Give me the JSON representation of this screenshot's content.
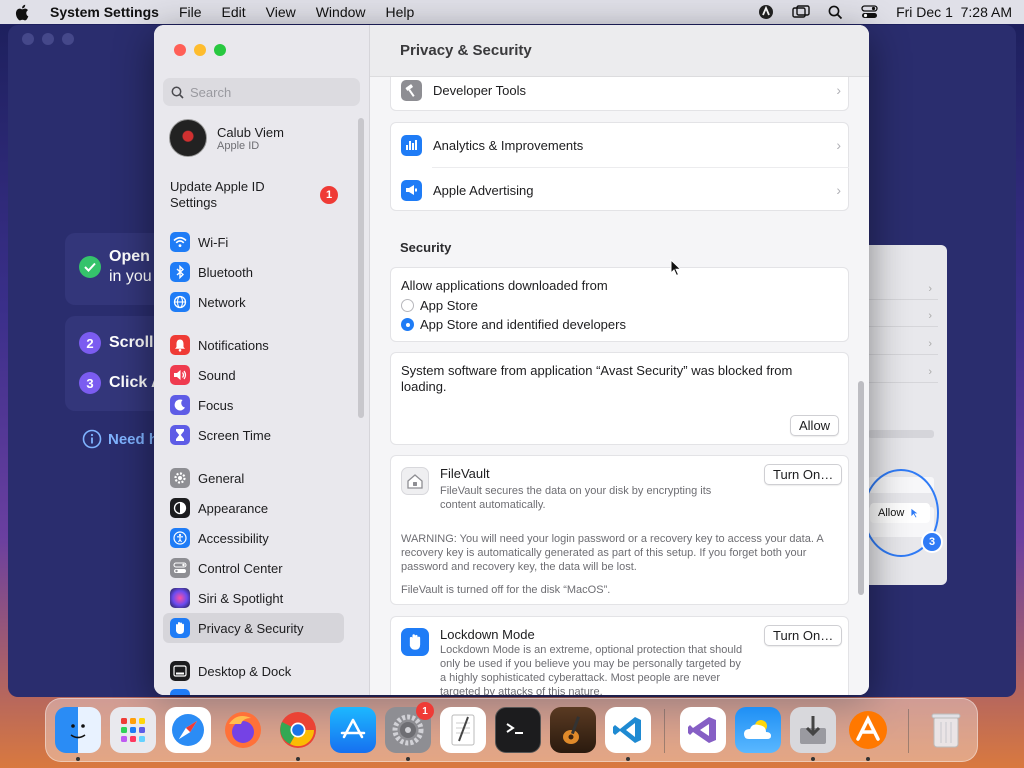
{
  "menubar": {
    "app_name": "System Settings",
    "menus": [
      "File",
      "Edit",
      "View",
      "Window",
      "Help"
    ],
    "datetime": "Fri Dec 1  7:28 AM"
  },
  "background_app": {
    "steps": [
      {
        "badge": "",
        "line1": "Open",
        "line2": "in you"
      },
      {
        "badge": "2",
        "text": "Scroll"
      },
      {
        "badge": "3",
        "text": "Click A"
      }
    ],
    "need_help": "Need h",
    "preview": {
      "allow_label": "Allow",
      "badge": "3"
    }
  },
  "sidebar": {
    "search_placeholder": "Search",
    "profile": {
      "name": "Calub Viem",
      "subtitle": "Apple ID"
    },
    "update": {
      "label": "Update Apple ID Settings",
      "badge": "1"
    },
    "items": [
      {
        "label": "Wi-Fi",
        "icon": "wifi-icon",
        "color": "#1f7cf6"
      },
      {
        "label": "Bluetooth",
        "icon": "bluetooth-icon",
        "color": "#1f7cf6"
      },
      {
        "label": "Network",
        "icon": "globe-icon",
        "color": "#1f7cf6"
      },
      {
        "label": "Notifications",
        "icon": "bell-icon",
        "color": "#ef3b36"
      },
      {
        "label": "Sound",
        "icon": "speaker-icon",
        "color": "#ef3b4f"
      },
      {
        "label": "Focus",
        "icon": "moon-icon",
        "color": "#5e5ce6"
      },
      {
        "label": "Screen Time",
        "icon": "hourglass-icon",
        "color": "#5e5ce6"
      },
      {
        "label": "General",
        "icon": "gear-icon",
        "color": "#8e8e93"
      },
      {
        "label": "Appearance",
        "icon": "appearance-icon",
        "color": "#1c1c1e"
      },
      {
        "label": "Accessibility",
        "icon": "accessibility-icon",
        "color": "#1f7cf6"
      },
      {
        "label": "Control Center",
        "icon": "switches-icon",
        "color": "#8e8e93"
      },
      {
        "label": "Siri & Spotlight",
        "icon": "siri-icon",
        "color": "#2b2b6e"
      },
      {
        "label": "Privacy & Security",
        "icon": "hand-icon",
        "color": "#1f7cf6"
      },
      {
        "label": "Desktop & Dock",
        "icon": "dock-icon",
        "color": "#1c1c1e"
      }
    ]
  },
  "content": {
    "title": "Privacy & Security",
    "rows_top": [
      {
        "label": "Developer Tools",
        "icon": "hammer-icon"
      },
      {
        "label": "Analytics & Improvements",
        "icon": "chart-icon"
      },
      {
        "label": "Apple Advertising",
        "icon": "megaphone-icon"
      }
    ],
    "security_title": "Security",
    "allow_from_label": "Allow applications downloaded from",
    "radio_options": [
      "App Store",
      "App Store and identified developers"
    ],
    "blocked_message": "System software from application “Avast Security” was blocked from loading.",
    "allow_button": "Allow",
    "filevault": {
      "title": "FileVault",
      "description": "FileVault secures the data on your disk by encrypting its content automatically.",
      "button": "Turn On…",
      "warning": "WARNING: You will need your login password or a recovery key to access your data. A recovery key is automatically generated as part of this setup. If you forget both your password and recovery key, the data will be lost.",
      "status": "FileVault is turned off for the disk “MacOS”."
    },
    "lockdown": {
      "title": "Lockdown Mode",
      "description": "Lockdown Mode is an extreme, optional protection that should only be used if you believe you may be personally targeted by a highly sophisticated cyberattack. Most people are never targeted by attacks of this nature.",
      "button": "Turn On…"
    }
  },
  "dock": {
    "settings_badge": "1",
    "apps": [
      "finder-icon",
      "launchpad-icon",
      "safari-icon",
      "firefox-icon",
      "chrome-icon",
      "appstore-icon",
      "settings-icon",
      "textedit-icon",
      "terminal-icon",
      "garageband-icon",
      "vscode-icon",
      "visualstudio-icon",
      "weather-icon",
      "installer-icon",
      "avast-icon",
      "trash-icon"
    ]
  }
}
